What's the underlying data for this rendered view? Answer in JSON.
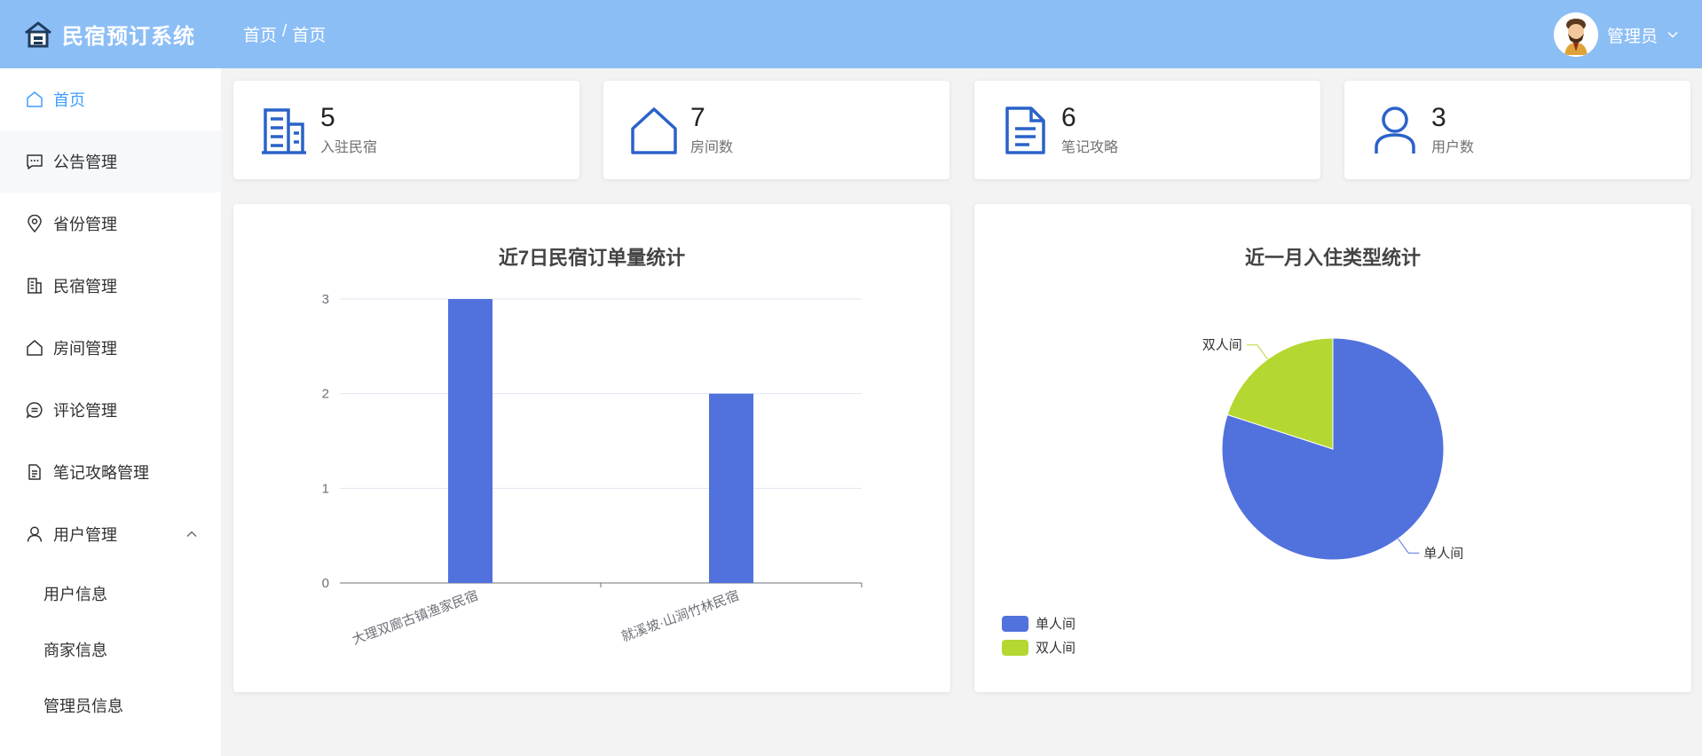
{
  "app": {
    "title": "民宿预订系统"
  },
  "breadcrumb": {
    "parent": "首页",
    "separator": "/",
    "current": "首页"
  },
  "user": {
    "name": "管理员"
  },
  "sidebar": {
    "items": [
      {
        "label": "首页",
        "icon": "home-icon",
        "active": true
      },
      {
        "label": "公告管理",
        "icon": "message-icon"
      },
      {
        "label": "省份管理",
        "icon": "location-icon"
      },
      {
        "label": "民宿管理",
        "icon": "building-icon"
      },
      {
        "label": "房间管理",
        "icon": "house-icon"
      },
      {
        "label": "评论管理",
        "icon": "comment-icon"
      },
      {
        "label": "笔记攻略管理",
        "icon": "document-icon"
      },
      {
        "label": "用户管理",
        "icon": "user-icon",
        "expanded": true
      }
    ],
    "sub_items": [
      "用户信息",
      "商家信息",
      "管理员信息"
    ]
  },
  "stats": [
    {
      "value": "5",
      "label": "入驻民宿",
      "icon": "building-icon"
    },
    {
      "value": "7",
      "label": "房间数",
      "icon": "house-icon"
    },
    {
      "value": "6",
      "label": "笔记攻略",
      "icon": "document-icon"
    },
    {
      "value": "3",
      "label": "用户数",
      "icon": "user-icon"
    }
  ],
  "colors": {
    "header": "#8cbef6",
    "accent": "#409eff",
    "icon_blue": "#2a62c9",
    "bar": "#5171dd",
    "pie_single": "#5171dd",
    "pie_double": "#b5d732"
  },
  "chart_data": [
    {
      "type": "bar",
      "title": "近7日民宿订单量统计",
      "categories": [
        "大理双廊古镇渔家民宿",
        "就溪坡·山涧竹林民宿"
      ],
      "values": [
        3,
        2
      ],
      "ylim": [
        0,
        3
      ],
      "yticks": [
        "0",
        "1",
        "2",
        "3"
      ],
      "grid": true
    },
    {
      "type": "pie",
      "title": "近一月入住类型统计",
      "labels": [
        "单人间",
        "双人间"
      ],
      "values": [
        4,
        1
      ],
      "legend": "bottom-left"
    }
  ]
}
